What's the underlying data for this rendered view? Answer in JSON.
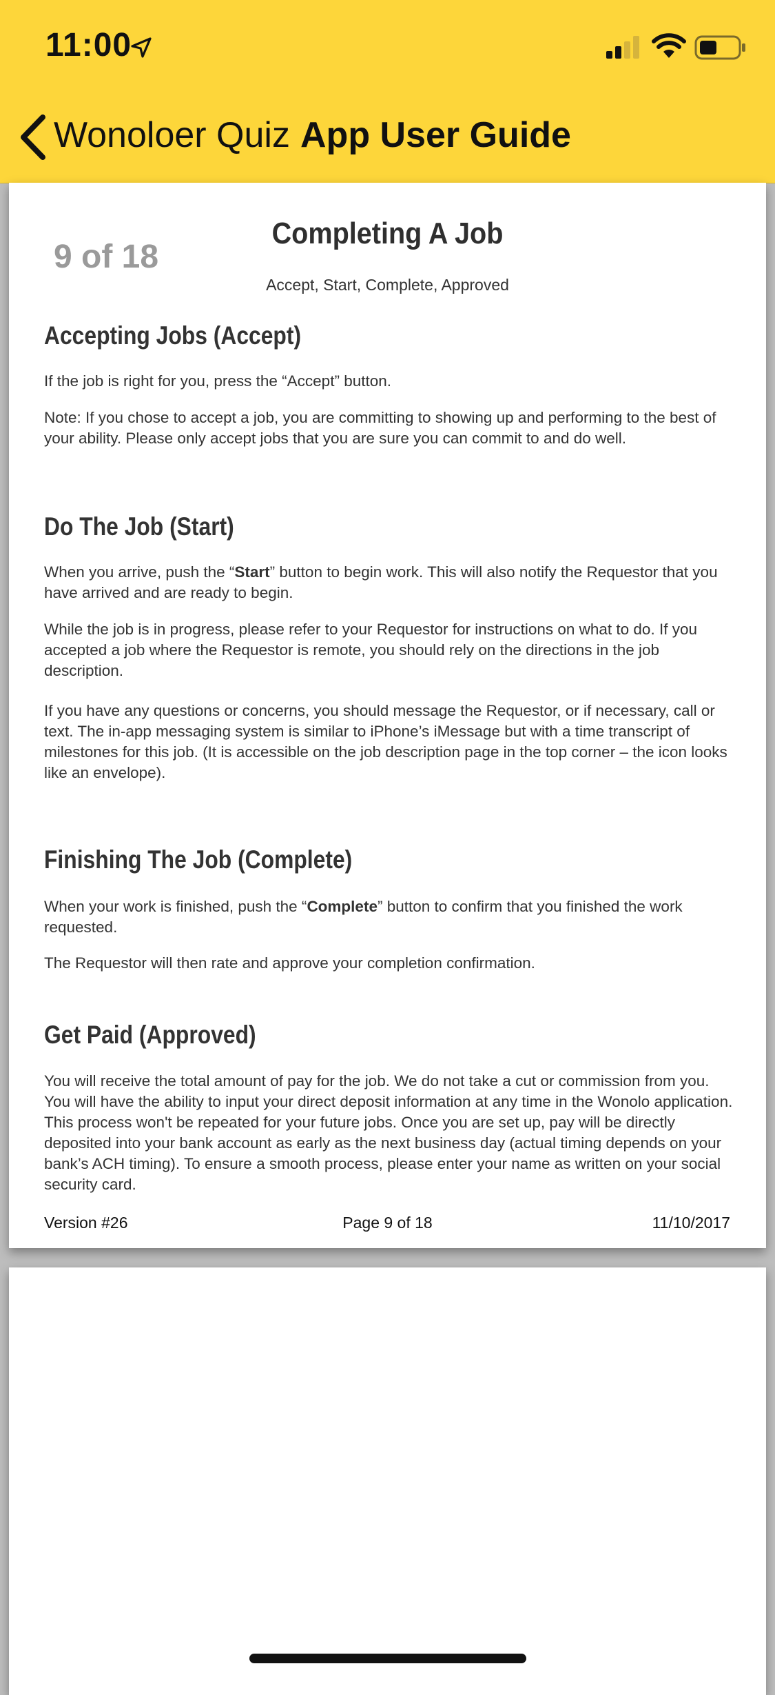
{
  "status_bar": {
    "time": "11:00"
  },
  "nav": {
    "back_label": "Wonoloer Quiz",
    "title": "App User Guide"
  },
  "page_indicator": "9 of 18",
  "document": {
    "title": "Completing A Job",
    "subtitle": "Accept, Start, Complete, Approved",
    "sections": [
      {
        "heading": "Accepting Jobs (Accept)",
        "paragraphs": [
          "If the job is right for you, press the “Accept” button.",
          "Note:  If you chose to accept a job, you are committing to showing up and performing to the best of your ability.  Please only accept jobs that you are sure you can commit to and do well."
        ]
      },
      {
        "heading": "Do The Job (Start)",
        "p1_before": "When you arrive, push the “",
        "p1_bold": "Start",
        "p1_after": "” button to begin work. This will also notify the Requestor that you have arrived and are ready to begin.",
        "paragraphs": [
          "While the job is in progress, please refer to your Requestor for instructions on what to do. If you accepted a job where the Requestor is remote, you should rely on the directions in the job description.",
          "If you have any questions or concerns, you should message the Requestor, or if necessary, call or text. The in-app messaging system is similar to iPhone’s iMessage but with a time transcript of milestones for this job. (It is accessible on the job description page in the top corner – the icon looks like an envelope)."
        ]
      },
      {
        "heading": "Finishing The Job (Complete)",
        "p1_before": "When your work is finished, push the “",
        "p1_bold": "Complete",
        "p1_after": "” button to confirm that you finished the work requested.",
        "paragraphs": [
          "The Requestor will then rate and approve your completion confirmation."
        ]
      },
      {
        "heading": "Get Paid (Approved)",
        "paragraphs": [
          "You will receive the total amount of pay for the job. We do not take a cut or commission from you. You will have the ability to input your direct deposit information at any time in the Wonolo application. This process won't be repeated for your future jobs. Once you are set up, pay will be directly deposited into your bank account as early as the next business day (actual timing depends on your bank’s ACH timing). To ensure a smooth process, please enter your name as written on your social security card."
        ]
      }
    ],
    "footer": {
      "version": "Version #26",
      "page": "Page 9 of 18",
      "date": "11/10/2017"
    }
  },
  "icons": {
    "location": "location-arrow-icon",
    "signal": "cellular-signal-icon",
    "wifi": "wifi-icon",
    "battery": "battery-icon",
    "back": "chevron-left-icon"
  }
}
